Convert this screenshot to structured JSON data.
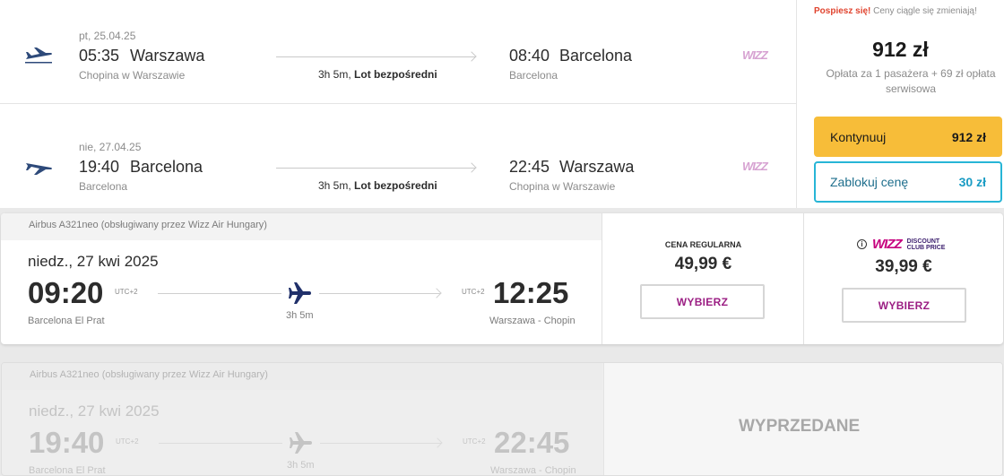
{
  "legs": [
    {
      "date": "pt, 25.04.25",
      "dep_time": "05:35",
      "dep_city": "Warszawa",
      "dep_airport": "Chopina w Warszawie",
      "duration": "3h 5m,",
      "direct": "Lot bezpośredni",
      "arr_time": "08:40",
      "arr_city": "Barcelona",
      "arr_airport": "Barcelona",
      "carrier_logo": "wizz"
    },
    {
      "date": "nie, 27.04.25",
      "dep_time": "19:40",
      "dep_city": "Barcelona",
      "dep_airport": "Barcelona",
      "duration": "3h 5m,",
      "direct": "Lot bezpośredni",
      "arr_time": "22:45",
      "arr_city": "Warszawa",
      "arr_airport": "Chopina w Warszawie",
      "carrier_logo": "wizz"
    }
  ],
  "summary": {
    "hurry_hot": "Pospiesz się!",
    "hurry_rest": "Ceny ciągle się zmieniają!",
    "price": "912 zł",
    "price_note": "Opłata za 1 pasażera + 69 zł opłata serwisowa",
    "continue_label": "Kontynuuj",
    "continue_price": "912 zł",
    "block_label": "Zablokuj cenę",
    "block_price": "30 zł"
  },
  "flights": [
    {
      "aircraft": "Airbus A321neo (obsługiwany przez Wizz Air Hungary)",
      "date": "niedz., 27 kwi 2025",
      "dep_time": "09:20",
      "dep_utc": "UTC+2",
      "dep_airport": "Barcelona El Prat",
      "duration": "3h 5m",
      "arr_time": "12:25",
      "arr_utc": "UTC+2",
      "arr_airport": "Warszawa - Chopin",
      "regular_label": "CENA REGULARNA",
      "regular_price": "49,99 €",
      "club_logo_text": "WIZZ",
      "club_logo_sub1": "DISCOUNT",
      "club_logo_sub2": "CLUB PRICE",
      "club_price": "39,99 €",
      "select_label": "WYBIERZ"
    },
    {
      "aircraft": "Airbus A321neo (obsługiwany przez Wizz Air Hungary)",
      "date": "niedz., 27 kwi 2025",
      "dep_time": "19:40",
      "dep_utc": "UTC+2",
      "dep_airport": "Barcelona El Prat",
      "duration": "3h 5m",
      "arr_time": "22:45",
      "arr_utc": "UTC+2",
      "arr_airport": "Warszawa - Chopin",
      "sold_out": "WYPRZEDANE"
    }
  ],
  "colors": {
    "accent_yellow": "#f7bd39",
    "accent_cyan": "#27b5d6",
    "wizz_magenta": "#9b1e83",
    "hurry_red": "#e0432e"
  }
}
